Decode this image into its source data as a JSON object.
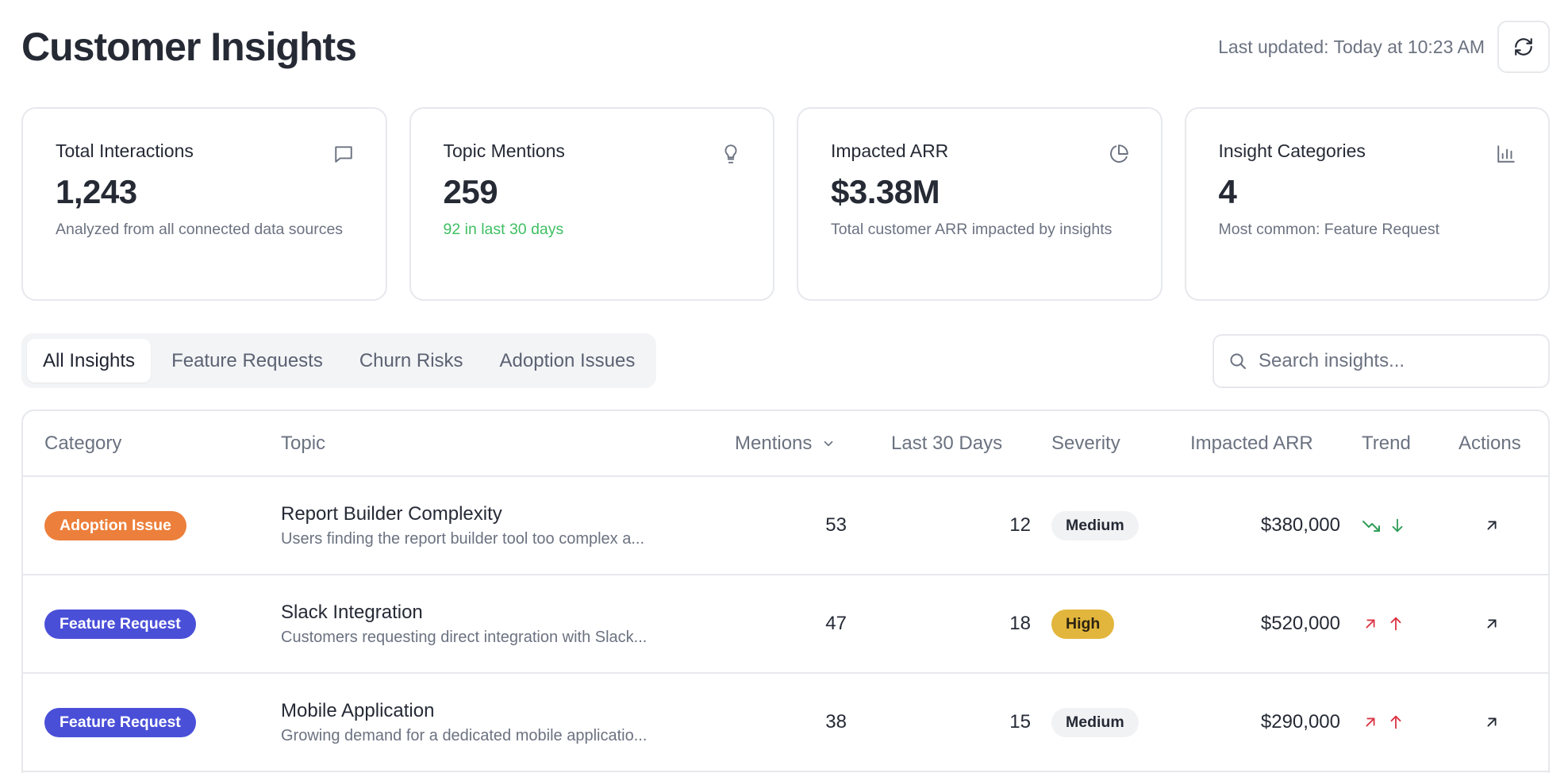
{
  "header": {
    "title": "Customer Insights",
    "last_updated": "Last updated: Today at 10:23 AM",
    "refresh_icon": "refresh-icon"
  },
  "cards": [
    {
      "title": "Total Interactions",
      "icon": "message-square-icon",
      "value": "1,243",
      "subtitle": "Analyzed from all connected data sources"
    },
    {
      "title": "Topic Mentions",
      "icon": "lightbulb-icon",
      "value": "259",
      "subtitle": "92 in last 30 days",
      "subtitle_color": "#3fbf62"
    },
    {
      "title": "Impacted ARR",
      "icon": "pie-chart-icon",
      "value": "$3.38M",
      "subtitle": "Total customer ARR impacted by insights"
    },
    {
      "title": "Insight Categories",
      "icon": "bar-chart-icon",
      "value": "4",
      "subtitle": "Most common: Feature Request"
    }
  ],
  "tabs": [
    "All Insights",
    "Feature Requests",
    "Churn Risks",
    "Adoption Issues"
  ],
  "active_tab": "All Insights",
  "search": {
    "placeholder": "Search insights...",
    "value": ""
  },
  "table": {
    "columns": [
      "Category",
      "Topic",
      "Mentions",
      "Last 30 Days",
      "Severity",
      "Impacted ARR",
      "Trend",
      "Actions"
    ],
    "sorted_column": "Mentions",
    "rows": [
      {
        "category": "Adoption Issue",
        "category_color": "#ec7f3b",
        "topic": "Report Builder Complexity",
        "description": "Users finding the report builder tool too complex a...",
        "mentions": "53",
        "last30": "12",
        "severity": "Medium",
        "arr": "$380,000",
        "trend": "down",
        "trend_color": "#2f9e58"
      },
      {
        "category": "Feature Request",
        "category_color": "#4a4fd8",
        "topic": "Slack Integration",
        "description": "Customers requesting direct integration with Slack...",
        "mentions": "47",
        "last30": "18",
        "severity": "High",
        "arr": "$520,000",
        "trend": "up",
        "trend_color": "#dc3545"
      },
      {
        "category": "Feature Request",
        "category_color": "#4a4fd8",
        "topic": "Mobile Application",
        "description": "Growing demand for a dedicated mobile applicatio...",
        "mentions": "38",
        "last30": "15",
        "severity": "Medium",
        "arr": "$290,000",
        "trend": "up",
        "trend_color": "#dc3545"
      }
    ]
  }
}
